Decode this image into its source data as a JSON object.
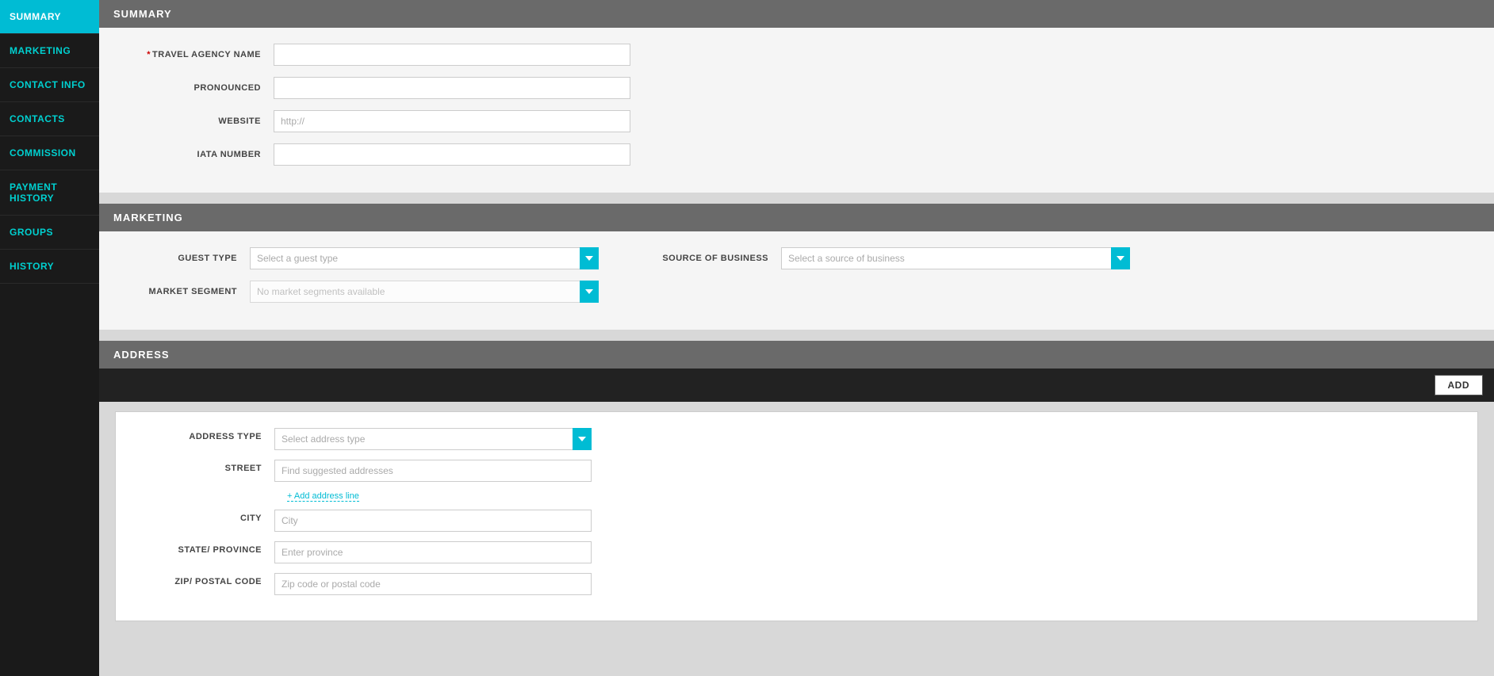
{
  "sidebar": {
    "items": [
      {
        "id": "summary",
        "label": "SUMMARY",
        "active": true
      },
      {
        "id": "marketing",
        "label": "MARKETING",
        "active": false
      },
      {
        "id": "contact-info",
        "label": "CONTACT INFO",
        "active": false
      },
      {
        "id": "contacts",
        "label": "CONTACTS",
        "active": false
      },
      {
        "id": "commission",
        "label": "COMMISSION",
        "active": false
      },
      {
        "id": "payment-history",
        "label": "PAYMENT HISTORY",
        "active": false
      },
      {
        "id": "groups",
        "label": "GROUPS",
        "active": false
      },
      {
        "id": "history",
        "label": "HISTORY",
        "active": false
      }
    ]
  },
  "summary": {
    "section_title": "SUMMARY",
    "fields": {
      "travel_agency_name_label": "TRAVEL AGENCY NAME",
      "travel_agency_name_placeholder": "",
      "pronounced_label": "PRONOUNCED",
      "pronounced_placeholder": "",
      "website_label": "WEBSITE",
      "website_placeholder": "http://",
      "iata_number_label": "IATA NUMBER",
      "iata_number_placeholder": ""
    }
  },
  "marketing": {
    "section_title": "MARKETING",
    "guest_type_label": "GUEST TYPE",
    "guest_type_placeholder": "Select a guest type",
    "source_of_business_label": "SOURCE OF BUSINESS",
    "source_of_business_placeholder": "Select a source of business",
    "market_segment_label": "MARKET SEGMENT",
    "market_segment_placeholder": "No market segments available"
  },
  "address": {
    "section_title": "ADDRESS",
    "add_button_label": "ADD",
    "address_type_label": "ADDRESS TYPE",
    "address_type_placeholder": "Select address type",
    "street_label": "STREET",
    "street_placeholder": "Find suggested addresses",
    "add_address_line_label": "+ Add address line",
    "city_label": "CITY",
    "city_placeholder": "City",
    "state_province_label": "STATE/ PROVINCE",
    "state_province_placeholder": "Enter province",
    "zip_postal_code_label": "ZIP/ POSTAL CODE",
    "zip_postal_code_placeholder": "Zip code or postal code"
  }
}
